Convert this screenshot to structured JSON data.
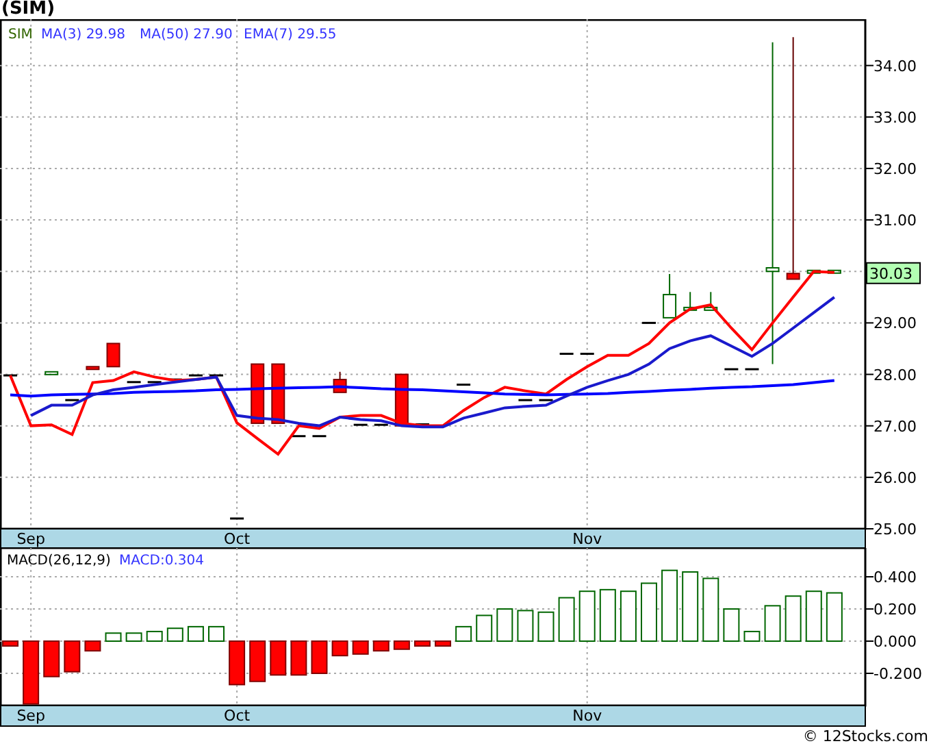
{
  "title": "(SIM)",
  "legend": {
    "symbol": "SIM",
    "readings": [
      "29.98",
      "27.90",
      "29.55"
    ]
  },
  "last_price": "30.03",
  "price_chart": {
    "chart_data": {
      "type": "line",
      "categories": [
        null,
        "Sep",
        null,
        null,
        null,
        null,
        null,
        null,
        null,
        null,
        null,
        "Oct",
        null,
        null,
        null,
        null,
        null,
        null,
        null,
        null,
        null,
        null,
        null,
        null,
        null,
        null,
        null,
        null,
        "Nov",
        null,
        null,
        null,
        null,
        null,
        null,
        null,
        null,
        null,
        null,
        null,
        null,
        null
      ],
      "ylim": [
        25.0,
        34.9
      ],
      "yticks": [
        {
          "value": 25,
          "label": "25.00"
        },
        {
          "value": 26,
          "label": "26.00"
        },
        {
          "value": 27,
          "label": "27.00"
        },
        {
          "value": 28,
          "label": "28.00"
        },
        {
          "value": 29,
          "label": "29.00"
        },
        {
          "value": 31,
          "label": "31.00"
        },
        {
          "value": 32,
          "label": "32.00"
        },
        {
          "value": 33,
          "label": "33.00"
        },
        {
          "value": 34,
          "label": "34.00"
        }
      ],
      "series": [
        {
          "name": "MA(3)",
          "color": "#ff0000",
          "values": [
            27.98,
            27.0,
            27.02,
            26.83,
            27.84,
            27.88,
            28.05,
            27.95,
            27.88,
            27.9,
            27.95,
            27.06,
            26.75,
            26.45,
            27.0,
            26.95,
            27.17,
            27.2,
            27.2,
            27.05,
            27.0,
            27.0,
            27.3,
            27.55,
            27.75,
            27.68,
            27.62,
            27.9,
            28.15,
            28.37,
            28.37,
            28.6,
            29.0,
            29.27,
            29.35,
            28.9,
            28.48,
            29.0,
            29.5,
            30.0,
            29.98,
            null
          ]
        },
        {
          "name": "MA(50)",
          "color": "#0000ff",
          "values": [
            27.6,
            27.58,
            27.6,
            27.61,
            27.62,
            27.63,
            27.65,
            27.66,
            27.67,
            27.68,
            27.7,
            27.71,
            27.72,
            27.73,
            27.74,
            27.75,
            27.76,
            27.74,
            27.72,
            27.71,
            27.7,
            27.68,
            27.66,
            27.64,
            27.62,
            27.61,
            27.6,
            27.61,
            27.62,
            27.63,
            27.65,
            27.67,
            27.69,
            27.71,
            27.73,
            27.75,
            27.76,
            27.78,
            27.8,
            27.84,
            27.88,
            null
          ]
        },
        {
          "name": "EMA(7)",
          "color": "#1a1acc",
          "values": [
            null,
            27.2,
            27.4,
            27.4,
            27.6,
            27.7,
            27.75,
            27.8,
            27.85,
            27.9,
            27.95,
            27.2,
            27.15,
            27.12,
            27.05,
            27.0,
            27.17,
            27.12,
            27.1,
            27.0,
            26.98,
            26.98,
            27.15,
            27.25,
            27.35,
            27.38,
            27.4,
            27.58,
            27.75,
            27.88,
            28.0,
            28.2,
            28.5,
            28.65,
            28.75,
            28.55,
            28.35,
            28.6,
            28.9,
            29.2,
            29.5,
            null
          ]
        }
      ],
      "grid": true
    }
  },
  "macd_chart": {
    "label": "MACD(26,12,9)",
    "reading": "MACD:0.304",
    "chart_data": {
      "type": "bar",
      "categories": [
        null,
        "Sep",
        null,
        null,
        null,
        null,
        null,
        null,
        null,
        null,
        null,
        "Oct",
        null,
        null,
        null,
        null,
        null,
        null,
        null,
        null,
        null,
        null,
        null,
        null,
        null,
        null,
        null,
        null,
        "Nov",
        null,
        null,
        null,
        null,
        null,
        null,
        null,
        null,
        null,
        null,
        null,
        null,
        null
      ],
      "ylim": [
        -0.4,
        0.579
      ],
      "yticks": [
        {
          "value": -0.2,
          "label": "-0.200"
        },
        {
          "value": 0,
          "label": "0.000"
        },
        {
          "value": 0.2,
          "label": "0.200"
        },
        {
          "value": 0.4,
          "label": "0.400"
        }
      ],
      "values": [
        -0.03,
        -0.39,
        -0.22,
        -0.19,
        -0.06,
        0.05,
        0.05,
        0.06,
        0.08,
        0.09,
        0.09,
        -0.27,
        -0.25,
        -0.21,
        -0.21,
        -0.2,
        -0.09,
        -0.08,
        -0.06,
        -0.05,
        -0.03,
        -0.03,
        0.09,
        0.16,
        0.2,
        0.19,
        0.18,
        0.27,
        0.31,
        0.32,
        0.31,
        0.36,
        0.44,
        0.43,
        0.39,
        0.2,
        0.06,
        0.22,
        0.28,
        0.31,
        0.3,
        null
      ],
      "grid": true
    }
  },
  "footer": "© 12Stocks.com"
}
